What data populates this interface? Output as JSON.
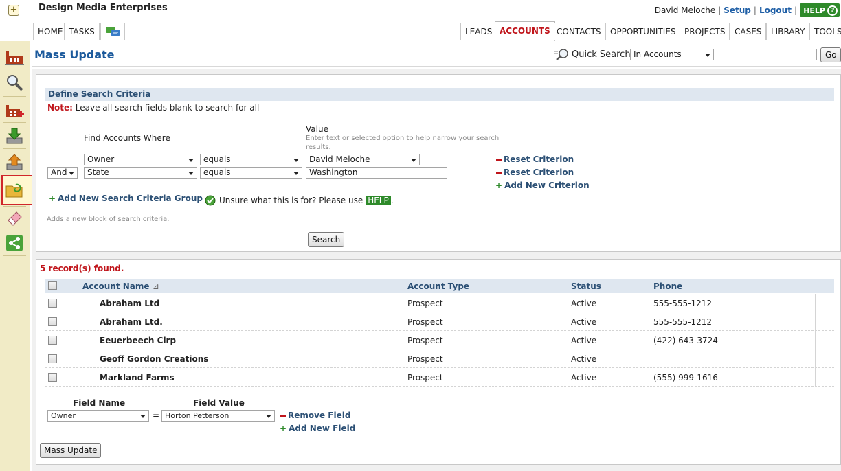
{
  "header": {
    "company": "Design Media Enterprises",
    "user": "David Meloche",
    "setup": "Setup",
    "logout": "Logout",
    "help": "HELP",
    "help_q": "?"
  },
  "left_tabs": [
    "HOME",
    "TASKS"
  ],
  "right_tabs": [
    "LEADS",
    "ACCOUNTS",
    "CONTACTS",
    "OPPORTUNITIES",
    "PROJECTS",
    "CASES",
    "LIBRARY",
    "TOOLS"
  ],
  "active_tab": "ACCOUNTS",
  "page": {
    "title": "Mass Update",
    "quick_search_label": "Quick Search",
    "quick_search_scope": "In Accounts",
    "quick_search_value": "",
    "go": "Go"
  },
  "criteria": {
    "heading": "Define Search Criteria",
    "note_label": "Note:",
    "note_text": " Leave all search fields blank to search for all",
    "find_where": "Find Accounts Where",
    "value_label": "Value",
    "value_hint": "Enter text or selected option to help narrow your search results.",
    "rows": [
      {
        "conj": "",
        "field": "Owner",
        "op": "equals",
        "value": "David Meloche",
        "reset": "Reset Criterion"
      },
      {
        "conj": "And",
        "field": "State",
        "op": "equals",
        "value": "Washington",
        "reset": "Reset Criterion"
      }
    ],
    "add_criterion": "Add New Criterion",
    "add_group": "Add New Search Criteria Group",
    "add_group_hint": "Adds a new block of search criteria.",
    "unsure": "Unsure what this is for? Please use",
    "unsure_help": "HELP",
    "unsure_end": ".",
    "search_button": "Search"
  },
  "results": {
    "found": "5 record(s) found.",
    "columns": [
      "Account Name",
      "Account Type",
      "Status",
      "Phone"
    ],
    "sort_indicator": "⊿",
    "rows": [
      {
        "name": "Abraham Ltd",
        "type": "Prospect",
        "status": "Active",
        "phone": "555-555-1212"
      },
      {
        "name": "Abraham Ltd.",
        "type": "Prospect",
        "status": "Active",
        "phone": "555-555-1212"
      },
      {
        "name": "Eeuerbeech Cirp",
        "type": "Prospect",
        "status": "Active",
        "phone": "(422) 643-3724"
      },
      {
        "name": "Geoff Gordon Creations",
        "type": "Prospect",
        "status": "Active",
        "phone": ""
      },
      {
        "name": "Markland Farms",
        "type": "Prospect",
        "status": "Active",
        "phone": "(555) 999-1616"
      }
    ]
  },
  "update": {
    "field_name_label": "Field Name",
    "field_value_label": "Field Value",
    "field": "Owner",
    "equals": "=",
    "value": "Horton Petterson",
    "remove": "Remove Field",
    "add": "Add New Field",
    "mass_update_button": "Mass Update"
  },
  "colors": {
    "accent": "#c0151b",
    "title": "#1c5a9c",
    "link": "#2b4f74",
    "help": "#2e8a2a"
  }
}
